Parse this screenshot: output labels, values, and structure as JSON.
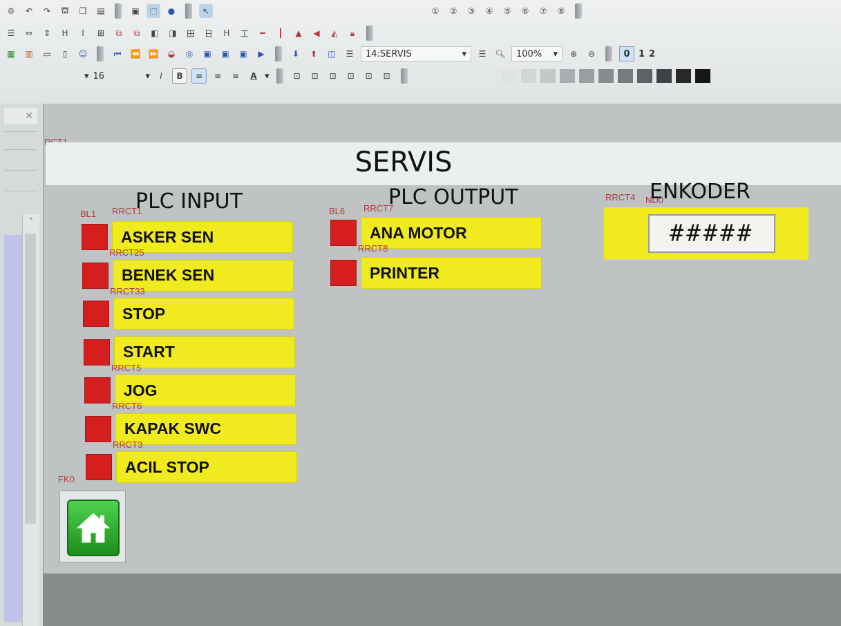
{
  "toolbar": {
    "font_size": "16",
    "screen_select": "14:SERVIS",
    "zoom": "100%",
    "toggle_0": "0",
    "toggle_1": "1",
    "toggle_2": "2"
  },
  "screen": {
    "title": "SERVIS",
    "title_tag": "RCT1",
    "plc_input": {
      "heading": "PLC INPUT",
      "heading_tags": [
        "BL1",
        "RRCT1"
      ],
      "items": [
        {
          "label": "ASKER SEN",
          "tag": "RRCT25"
        },
        {
          "label": "BENEK SEN",
          "tag": "RRCT33"
        },
        {
          "label": "STOP",
          "tag": ""
        },
        {
          "label": "START",
          "tag": "RRCT5"
        },
        {
          "label": "JOG",
          "tag": "RRCT6"
        },
        {
          "label": "KAPAK SWC",
          "tag": "RRCT3"
        },
        {
          "label": "ACIL STOP",
          "tag": ""
        }
      ]
    },
    "plc_output": {
      "heading": "PLC OUTPUT",
      "heading_tags": [
        "BL6",
        "RRCT7"
      ],
      "items": [
        {
          "label": "ANA MOTOR",
          "tag": "RRCT8"
        },
        {
          "label": "PRINTER",
          "tag": ""
        }
      ]
    },
    "encoder": {
      "heading": "ENKODER",
      "tags": [
        "RRCT4",
        "ND0"
      ],
      "value": "#####"
    },
    "home_tag": "FK0",
    "colors": {
      "led": "#d51f1f",
      "label_bg": "#f0ea1f",
      "home_green": "#2fae2f"
    }
  }
}
